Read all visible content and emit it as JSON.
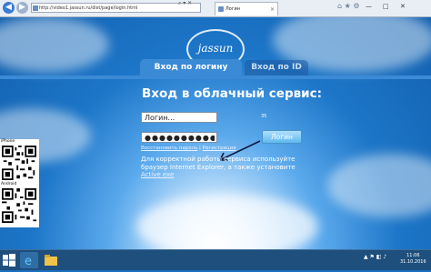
{
  "browser": {
    "address": "http://video1.jassun.ru/dist/page/login.html",
    "tab_title": "Логин",
    "tab_close": "×",
    "back": "◀",
    "forward": "▶",
    "addr_tools": "⌕ ▾ ✕",
    "min": "—",
    "max": "□",
    "close": "✕",
    "ie_icons": "⌂ ★ ⚙"
  },
  "page": {
    "logo": "jassun",
    "tab_login": "Вход по логину",
    "tab_id": "Вход по ID",
    "heading": "Вход в облачный сервис:",
    "login_value": "Логин...",
    "password_value": "●●●●●●●●●●",
    "login_button": "Логин",
    "small_digit": "35",
    "link_restore": "Восстановить пароль",
    "link_sep": " | ",
    "link_register": "Регистрация",
    "note_text": "Для корректной работы сервиса используйте браузер Internet Explorer, а также установите ",
    "note_link": "Active exe"
  },
  "qr": {
    "iphone_label": "iPhone",
    "android_label": "Android"
  },
  "taskbar": {
    "tray": "▲ ⚑ ◧ ♪",
    "time": "11:06",
    "date": "31.10.2016"
  }
}
